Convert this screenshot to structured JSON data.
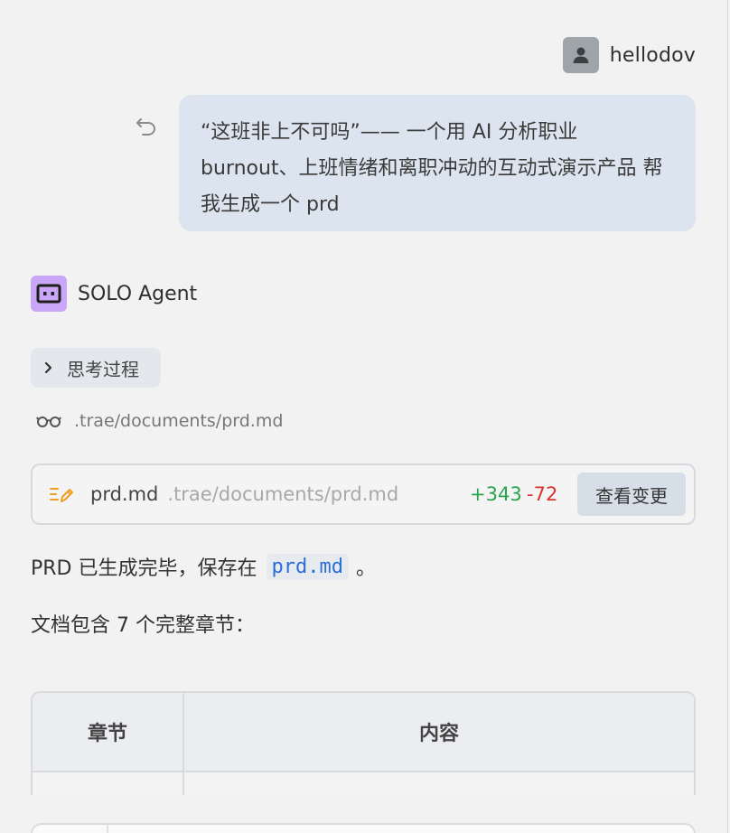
{
  "user": {
    "name": "hellodov"
  },
  "message": {
    "text": "“这班非上不可吗”—— 一个用 AI 分析职业 burnout、上班情绪和离职冲动的互动式演示产品 帮我生成一个 prd"
  },
  "agent": {
    "name": "SOLO Agent"
  },
  "thinking": {
    "label": "思考过程"
  },
  "viewed_file": {
    "path": ".trae/documents/prd.md"
  },
  "edit_card": {
    "file_name": "prd.md",
    "file_path": ".trae/documents/prd.md",
    "additions": "+343",
    "deletions": "-72",
    "view_changes_label": "查看变更"
  },
  "response": {
    "para1_prefix": "PRD 已生成完毕，保存在",
    "para1_code": "prd.md",
    "para1_suffix": "。",
    "para2": "文档包含 7 个完整章节："
  },
  "table": {
    "headers": [
      "章节",
      "内容"
    ]
  },
  "colors": {
    "user_bubble": "#dce5ef",
    "agent_avatar": "#c9a6f7",
    "diff_add": "#2ca34e",
    "diff_del": "#d9342b",
    "code_text": "#2c6fd4"
  }
}
